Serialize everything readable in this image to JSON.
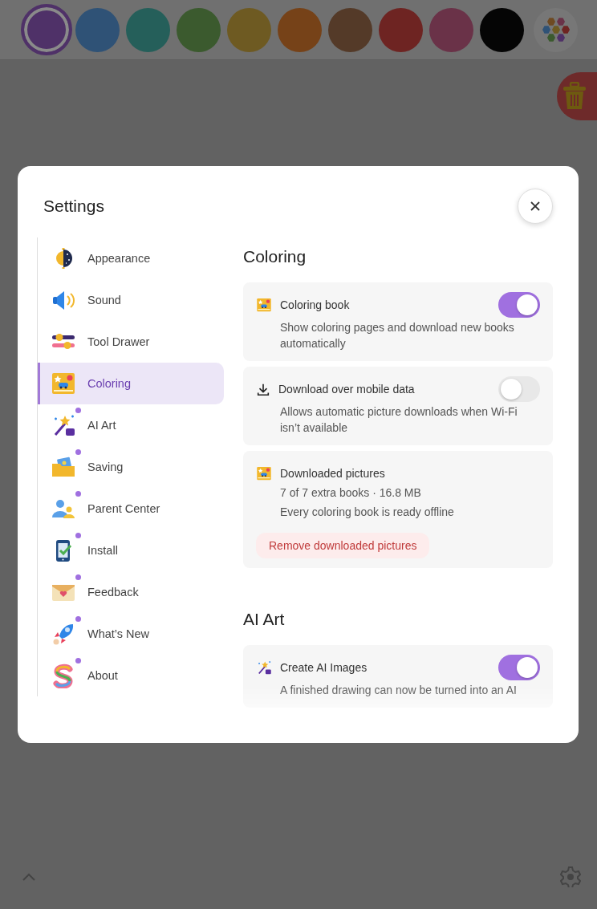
{
  "palette": [
    {
      "color": "#4f3168",
      "selected": true
    },
    {
      "color": "#2f5276",
      "selected": false
    },
    {
      "color": "#255f5a",
      "selected": false
    },
    {
      "color": "#3b5a2e",
      "selected": false
    },
    {
      "color": "#6e5a22",
      "selected": false
    },
    {
      "color": "#764218",
      "selected": false
    },
    {
      "color": "#543a28",
      "selected": false
    },
    {
      "color": "#6e2422",
      "selected": false
    },
    {
      "color": "#6a3248",
      "selected": false
    },
    {
      "color": "#050505",
      "selected": false
    }
  ],
  "dialog": {
    "title": "Settings",
    "sidebar": {
      "items": [
        {
          "label": "Appearance",
          "kind": "appearance",
          "selected": false,
          "badge": false
        },
        {
          "label": "Sound",
          "kind": "sound",
          "selected": false,
          "badge": false
        },
        {
          "label": "Tool Drawer",
          "kind": "tools",
          "selected": false,
          "badge": false
        },
        {
          "label": "Coloring",
          "kind": "coloring",
          "selected": true,
          "badge": false
        },
        {
          "label": "AI Art",
          "kind": "ai",
          "selected": false,
          "badge": true
        },
        {
          "label": "Saving",
          "kind": "saving",
          "selected": false,
          "badge": true
        },
        {
          "label": "Parent Center",
          "kind": "parent",
          "selected": false,
          "badge": true
        },
        {
          "label": "Install",
          "kind": "install",
          "selected": false,
          "badge": true
        },
        {
          "label": "Feedback",
          "kind": "feedback",
          "selected": false,
          "badge": true
        },
        {
          "label": "What’s New",
          "kind": "rocket",
          "selected": false,
          "badge": true
        },
        {
          "label": "About",
          "kind": "about",
          "selected": false,
          "badge": true
        }
      ]
    },
    "sections": [
      {
        "title": "Coloring",
        "cards": [
          {
            "kind": "toggle",
            "title": "Coloring book",
            "on": true,
            "description": "Show coloring pages and download new books automatically"
          },
          {
            "kind": "toggle",
            "title": "Download over mobile data",
            "on": false,
            "description": "Allows automatic picture downloads when Wi-Fi isn’t available"
          },
          {
            "kind": "info",
            "title": "Downloaded pictures",
            "lines": [
              "7 of 7 extra books · 16.8 MB",
              "Every coloring book is ready offline"
            ],
            "button": "Remove downloaded pictures"
          }
        ]
      },
      {
        "title": "AI Art",
        "cards": [
          {
            "kind": "toggle",
            "title": "Create AI Images",
            "on": true,
            "description": "A finished drawing can now be turned into an AI"
          }
        ]
      }
    ]
  }
}
